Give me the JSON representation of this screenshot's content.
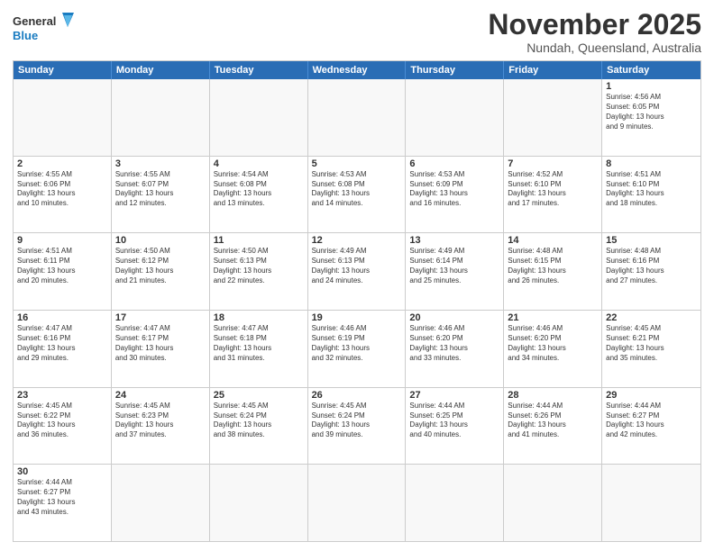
{
  "logo": {
    "text_general": "General",
    "text_blue": "Blue"
  },
  "title": {
    "month": "November 2025",
    "location": "Nundah, Queensland, Australia"
  },
  "calendar": {
    "headers": [
      "Sunday",
      "Monday",
      "Tuesday",
      "Wednesday",
      "Thursday",
      "Friday",
      "Saturday"
    ],
    "rows": [
      [
        {
          "day": "",
          "info": ""
        },
        {
          "day": "",
          "info": ""
        },
        {
          "day": "",
          "info": ""
        },
        {
          "day": "",
          "info": ""
        },
        {
          "day": "",
          "info": ""
        },
        {
          "day": "",
          "info": ""
        },
        {
          "day": "1",
          "info": "Sunrise: 4:56 AM\nSunset: 6:05 PM\nDaylight: 13 hours\nand 9 minutes."
        }
      ],
      [
        {
          "day": "2",
          "info": "Sunrise: 4:55 AM\nSunset: 6:06 PM\nDaylight: 13 hours\nand 10 minutes."
        },
        {
          "day": "3",
          "info": "Sunrise: 4:55 AM\nSunset: 6:07 PM\nDaylight: 13 hours\nand 12 minutes."
        },
        {
          "day": "4",
          "info": "Sunrise: 4:54 AM\nSunset: 6:08 PM\nDaylight: 13 hours\nand 13 minutes."
        },
        {
          "day": "5",
          "info": "Sunrise: 4:53 AM\nSunset: 6:08 PM\nDaylight: 13 hours\nand 14 minutes."
        },
        {
          "day": "6",
          "info": "Sunrise: 4:53 AM\nSunset: 6:09 PM\nDaylight: 13 hours\nand 16 minutes."
        },
        {
          "day": "7",
          "info": "Sunrise: 4:52 AM\nSunset: 6:10 PM\nDaylight: 13 hours\nand 17 minutes."
        },
        {
          "day": "8",
          "info": "Sunrise: 4:51 AM\nSunset: 6:10 PM\nDaylight: 13 hours\nand 18 minutes."
        }
      ],
      [
        {
          "day": "9",
          "info": "Sunrise: 4:51 AM\nSunset: 6:11 PM\nDaylight: 13 hours\nand 20 minutes."
        },
        {
          "day": "10",
          "info": "Sunrise: 4:50 AM\nSunset: 6:12 PM\nDaylight: 13 hours\nand 21 minutes."
        },
        {
          "day": "11",
          "info": "Sunrise: 4:50 AM\nSunset: 6:13 PM\nDaylight: 13 hours\nand 22 minutes."
        },
        {
          "day": "12",
          "info": "Sunrise: 4:49 AM\nSunset: 6:13 PM\nDaylight: 13 hours\nand 24 minutes."
        },
        {
          "day": "13",
          "info": "Sunrise: 4:49 AM\nSunset: 6:14 PM\nDaylight: 13 hours\nand 25 minutes."
        },
        {
          "day": "14",
          "info": "Sunrise: 4:48 AM\nSunset: 6:15 PM\nDaylight: 13 hours\nand 26 minutes."
        },
        {
          "day": "15",
          "info": "Sunrise: 4:48 AM\nSunset: 6:16 PM\nDaylight: 13 hours\nand 27 minutes."
        }
      ],
      [
        {
          "day": "16",
          "info": "Sunrise: 4:47 AM\nSunset: 6:16 PM\nDaylight: 13 hours\nand 29 minutes."
        },
        {
          "day": "17",
          "info": "Sunrise: 4:47 AM\nSunset: 6:17 PM\nDaylight: 13 hours\nand 30 minutes."
        },
        {
          "day": "18",
          "info": "Sunrise: 4:47 AM\nSunset: 6:18 PM\nDaylight: 13 hours\nand 31 minutes."
        },
        {
          "day": "19",
          "info": "Sunrise: 4:46 AM\nSunset: 6:19 PM\nDaylight: 13 hours\nand 32 minutes."
        },
        {
          "day": "20",
          "info": "Sunrise: 4:46 AM\nSunset: 6:20 PM\nDaylight: 13 hours\nand 33 minutes."
        },
        {
          "day": "21",
          "info": "Sunrise: 4:46 AM\nSunset: 6:20 PM\nDaylight: 13 hours\nand 34 minutes."
        },
        {
          "day": "22",
          "info": "Sunrise: 4:45 AM\nSunset: 6:21 PM\nDaylight: 13 hours\nand 35 minutes."
        }
      ],
      [
        {
          "day": "23",
          "info": "Sunrise: 4:45 AM\nSunset: 6:22 PM\nDaylight: 13 hours\nand 36 minutes."
        },
        {
          "day": "24",
          "info": "Sunrise: 4:45 AM\nSunset: 6:23 PM\nDaylight: 13 hours\nand 37 minutes."
        },
        {
          "day": "25",
          "info": "Sunrise: 4:45 AM\nSunset: 6:24 PM\nDaylight: 13 hours\nand 38 minutes."
        },
        {
          "day": "26",
          "info": "Sunrise: 4:45 AM\nSunset: 6:24 PM\nDaylight: 13 hours\nand 39 minutes."
        },
        {
          "day": "27",
          "info": "Sunrise: 4:44 AM\nSunset: 6:25 PM\nDaylight: 13 hours\nand 40 minutes."
        },
        {
          "day": "28",
          "info": "Sunrise: 4:44 AM\nSunset: 6:26 PM\nDaylight: 13 hours\nand 41 minutes."
        },
        {
          "day": "29",
          "info": "Sunrise: 4:44 AM\nSunset: 6:27 PM\nDaylight: 13 hours\nand 42 minutes."
        }
      ],
      [
        {
          "day": "30",
          "info": "Sunrise: 4:44 AM\nSunset: 6:27 PM\nDaylight: 13 hours\nand 43 minutes."
        },
        {
          "day": "",
          "info": ""
        },
        {
          "day": "",
          "info": ""
        },
        {
          "day": "",
          "info": ""
        },
        {
          "day": "",
          "info": ""
        },
        {
          "day": "",
          "info": ""
        },
        {
          "day": "",
          "info": ""
        }
      ]
    ]
  }
}
